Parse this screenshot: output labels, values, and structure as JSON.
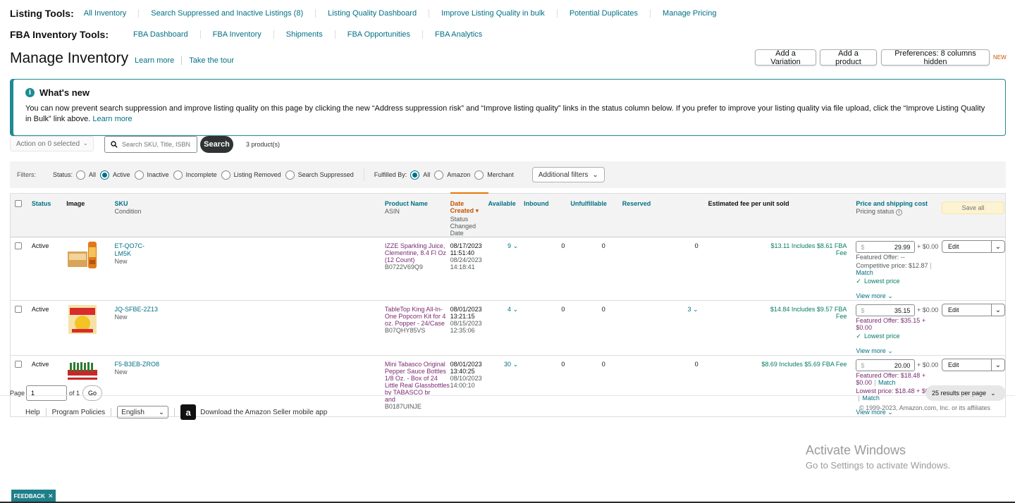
{
  "listing_tools": {
    "title": "Listing Tools:",
    "links": [
      "All Inventory",
      "Search Suppressed and Inactive Listings (8)",
      "Listing Quality Dashboard",
      "Improve Listing Quality in bulk",
      "Potential Duplicates",
      "Manage Pricing"
    ]
  },
  "fba_tools": {
    "title": "FBA Inventory Tools:",
    "links": [
      "FBA Dashboard",
      "FBA Inventory",
      "Shipments",
      "FBA Opportunities",
      "FBA Analytics"
    ]
  },
  "page": {
    "title": "Manage Inventory",
    "learn_more": "Learn more",
    "take_tour": "Take the tour"
  },
  "top_buttons": {
    "add_variation": "Add a Variation",
    "add_product": "Add a product",
    "preferences": "Preferences: 8 columns hidden",
    "new_badge": "NEW"
  },
  "whats_new": {
    "icon": "info-icon",
    "title": "What's new",
    "body": "You can now prevent search suppression and improve listing quality on this page by clicking the new “Address suppression risk” and “Improve listing quality” links in the status column below. If you prefer to improve your listing quality via file upload, click the “Improve Listing Quality in Bulk” link above.",
    "learn_more": "Learn more"
  },
  "toolbar": {
    "action_label": "Action on 0 selected",
    "search_placeholder": "Search SKU, Title, ISBN",
    "search_button": "Search",
    "product_count": "3 product(s)"
  },
  "filters": {
    "label": "Filters:",
    "status_label": "Status:",
    "status_options": [
      "All",
      "Active",
      "Inactive",
      "Incomplete",
      "Listing Removed",
      "Search Suppressed"
    ],
    "status_selected": "Active",
    "fulfilled_label": "Fulfilled By:",
    "fulfilled_options": [
      "All",
      "Amazon",
      "Merchant"
    ],
    "fulfilled_selected": "All",
    "additional_filters": "Additional filters"
  },
  "table": {
    "headers": {
      "status": "Status",
      "image": "Image",
      "sku": "SKU",
      "condition": "Condition",
      "product_name": "Product Name",
      "asin": "ASIN",
      "date_created": "Date Created",
      "status_changed": "Status Changed Date",
      "available": "Available",
      "inbound": "Inbound",
      "unfulfillable": "Unfulfillable",
      "reserved": "Reserved",
      "est_fee": "Estimated fee per unit sold",
      "price_shipping": "Price and shipping cost",
      "pricing_status": "Pricing status",
      "save_all": "Save all"
    },
    "rows": [
      {
        "status": "Active",
        "sku_line1": "ET-QO7C-",
        "sku_line2": "LM5K",
        "condition": "New",
        "product_name": "IZZE Sparkling Juice, Clementine, 8.4 Fl Oz (12 Count)",
        "asin": "B0722V69Q9",
        "date_created": "08/17/2023 11:51:40",
        "status_changed": "08/24/2023 14:18:41",
        "available": "9",
        "inbound": "0",
        "unfulfillable": "0",
        "reserved": "0",
        "est_fee": "$13.11 Includes $8.61 FBA",
        "est_fee_2": "Fee",
        "price": "29.99",
        "shipping": "+ $0.00",
        "featured_offer": "Featured Offer: --",
        "competitive": "Competitive price: $12.87",
        "match": "Match",
        "lowest": "Lowest price",
        "view_more": "View more",
        "edit": "Edit"
      },
      {
        "status": "Active",
        "sku_line1": "JQ-SFBE-2Z13",
        "sku_line2": "",
        "condition": "New",
        "product_name": "TableTop King All-In-One Popcorn Kit for 4 oz. Popper - 24/Case",
        "asin": "B07QHY85VS",
        "date_created": "08/01/2023 13:21:15",
        "status_changed": "08/15/2023 12:35:06",
        "available": "4",
        "inbound": "0",
        "unfulfillable": "0",
        "reserved": "3",
        "est_fee": "$14.84 Includes $9.57 FBA",
        "est_fee_2": "Fee",
        "price": "35.15",
        "shipping": "+ $0.00",
        "featured_offer": "Featured Offer: $35.15 + $0.00",
        "lowest": "Lowest price",
        "view_more": "View more",
        "edit": "Edit"
      },
      {
        "status": "Active",
        "sku_line1": "F5-B3EB-ZRO8",
        "sku_line2": "",
        "condition": "New",
        "product_name": "Mini Tabasco Original Pepper Sauce Bottles 1/8 Oz. - Box of 24 Little Real Glassbottles by TABASCO br",
        "product_name_2": "and",
        "asin": "B0187UINJE",
        "date_created": "08/01/2023 13:40:25",
        "status_changed": "08/10/2023 14:00:10",
        "available": "30",
        "inbound": "0",
        "unfulfillable": "0",
        "reserved": "0",
        "est_fee": "$8.69 Includes $5.69 FBA Fee",
        "price": "20.00",
        "shipping": "+ $0.00",
        "featured_offer": "Featured Offer: $18.48 + $0.00",
        "match": "Match",
        "lowest_price": "Lowest price: $18.48 + $0.00",
        "match2": "Match",
        "view_more": "View more",
        "edit": "Edit"
      }
    ]
  },
  "pager": {
    "page_label": "Page",
    "page_value": "1",
    "of_label": "of 1",
    "go": "Go",
    "results_per_page": "25 results per page"
  },
  "footer": {
    "help": "Help",
    "policies": "Program Policies",
    "language": "English",
    "app_link": "Download the Amazon Seller mobile app",
    "copyright": "© 1999-2023, Amazon.com, Inc. or its affiliates"
  },
  "overlay": {
    "activate_1": "Activate Windows",
    "activate_2": "Go to Settings to activate Windows.",
    "feedback": "FEEDBACK",
    "feedback_close": "✕"
  }
}
